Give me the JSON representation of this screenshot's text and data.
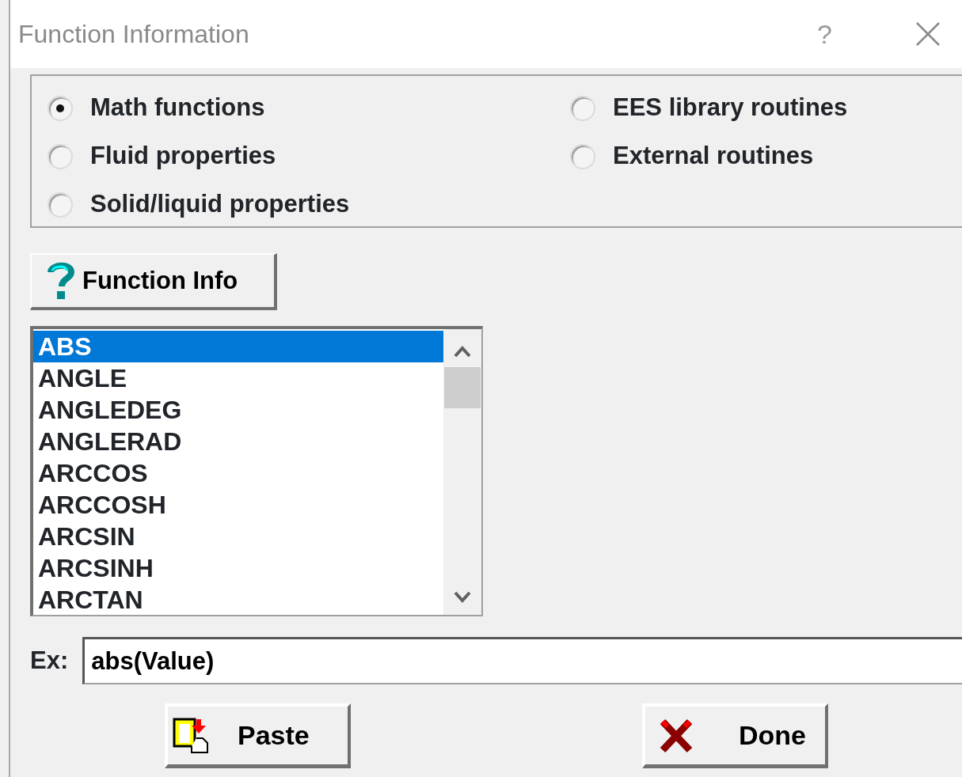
{
  "window": {
    "title": "Function Information",
    "help": "?"
  },
  "categories": [
    {
      "label": "Math functions",
      "selected": true
    },
    {
      "label": "Fluid properties",
      "selected": false
    },
    {
      "label": "Solid/liquid properties",
      "selected": false
    },
    {
      "label": "EES library routines",
      "selected": false
    },
    {
      "label": "External routines",
      "selected": false
    }
  ],
  "info_button": {
    "label": "Function Info"
  },
  "functions": [
    {
      "label": "ABS",
      "selected": true
    },
    {
      "label": "ANGLE",
      "selected": false
    },
    {
      "label": "ANGLEDEG",
      "selected": false
    },
    {
      "label": "ANGLERAD",
      "selected": false
    },
    {
      "label": "ARCCOS",
      "selected": false
    },
    {
      "label": "ARCCOSH",
      "selected": false
    },
    {
      "label": "ARCSIN",
      "selected": false
    },
    {
      "label": "ARCSINH",
      "selected": false
    },
    {
      "label": "ARCTAN",
      "selected": false
    }
  ],
  "example": {
    "label": "Ex:",
    "value": "abs(Value)"
  },
  "buttons": [
    {
      "kind": "paste",
      "label": "Paste"
    },
    {
      "kind": "done",
      "label": "Done"
    }
  ]
}
